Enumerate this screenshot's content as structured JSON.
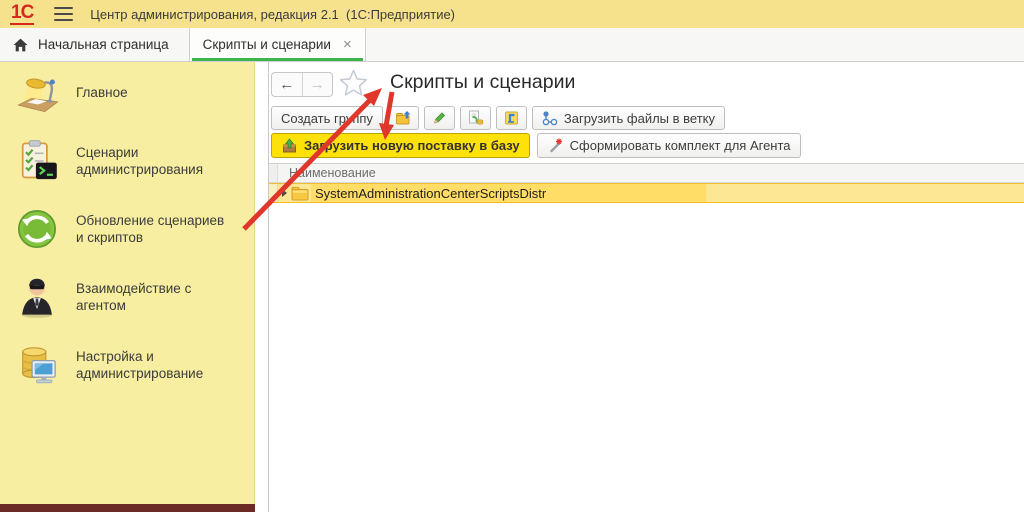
{
  "window": {
    "logo_text": "1С",
    "title": "Центр администрирования, редакция 2.1  (1С:Предприятие)"
  },
  "tabbar": {
    "home_tab": "Начальная страница",
    "active_tab": "Скрипты и сценарии",
    "close_glyph": "×"
  },
  "sidebar": {
    "items": [
      {
        "icon": "desk-lamp-icon",
        "label": "Главное"
      },
      {
        "icon": "scripts-clipboard-icon",
        "label": "Сценарии администрирования"
      },
      {
        "icon": "update-refresh-icon",
        "label": "Обновление сценариев и скриптов"
      },
      {
        "icon": "agent-person-icon",
        "label": "Взаимодействие с агентом"
      },
      {
        "icon": "database-computer-icon",
        "label": "Настройка и администрирование"
      }
    ]
  },
  "content": {
    "page_title": "Скрипты и сценарии",
    "nav": {
      "back_glyph": "←",
      "forward_glyph": "→"
    },
    "toolbar": {
      "create_group": "Создать группу",
      "upload_files_to_branch": "Загрузить файлы в ветку",
      "load_new_distribution": "Загрузить новую поставку в базу",
      "build_agent_kit": "Сформировать комплект для Агента"
    },
    "table": {
      "column_header": "Наименование",
      "rows": [
        {
          "icon": "folder-icon",
          "name": "SystemAdministrationCenterScriptsDistr"
        }
      ]
    }
  },
  "colors": {
    "topbar_yellow": "#F6E28C",
    "sidebar_yellow": "#F7EEA1",
    "active_tab_green": "#3CB54E",
    "accent_button_yellow": "#FFE10A",
    "row_selection_bright": "#FFDD66",
    "row_selection_pale": "#FDE795",
    "row_selection_border": "#EFBF2D",
    "annotation_arrow_red": "#E0372C",
    "logo_red": "#D6281E",
    "maroon_strip": "#6B2B24"
  }
}
